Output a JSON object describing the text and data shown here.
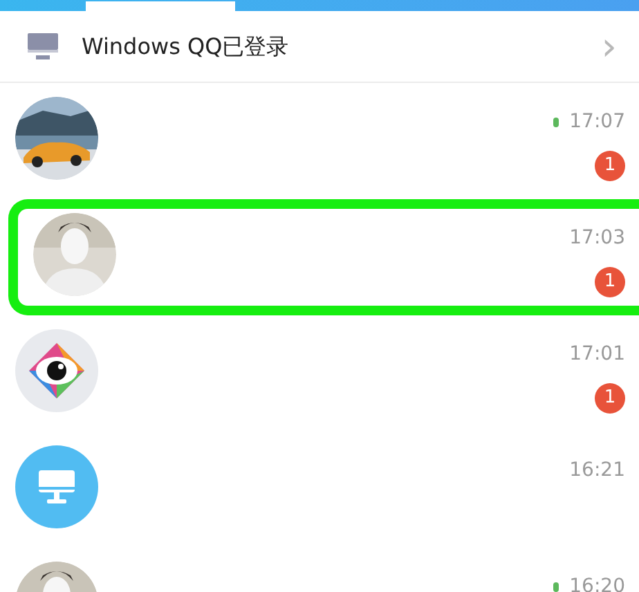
{
  "header": {
    "search": {
      "kind": "field"
    }
  },
  "device_banner": {
    "label": "Windows QQ已登录",
    "arrow": "›"
  },
  "chats": [
    {
      "avatar": {
        "kind": "car"
      },
      "time": "17:07",
      "status_dot": true,
      "badge": "1",
      "highlighted": false
    },
    {
      "avatar": {
        "kind": "person"
      },
      "time": "17:03",
      "status_dot": false,
      "badge": "1",
      "highlighted": true
    },
    {
      "avatar": {
        "kind": "eye"
      },
      "time": "17:01",
      "status_dot": false,
      "badge": "1",
      "highlighted": false
    },
    {
      "avatar": {
        "kind": "monitor"
      },
      "time": "16:21",
      "status_dot": false,
      "highlighted": false
    },
    {
      "avatar": {
        "kind": "person"
      },
      "time": "16:20",
      "status_dot": true,
      "highlighted": false
    }
  ]
}
